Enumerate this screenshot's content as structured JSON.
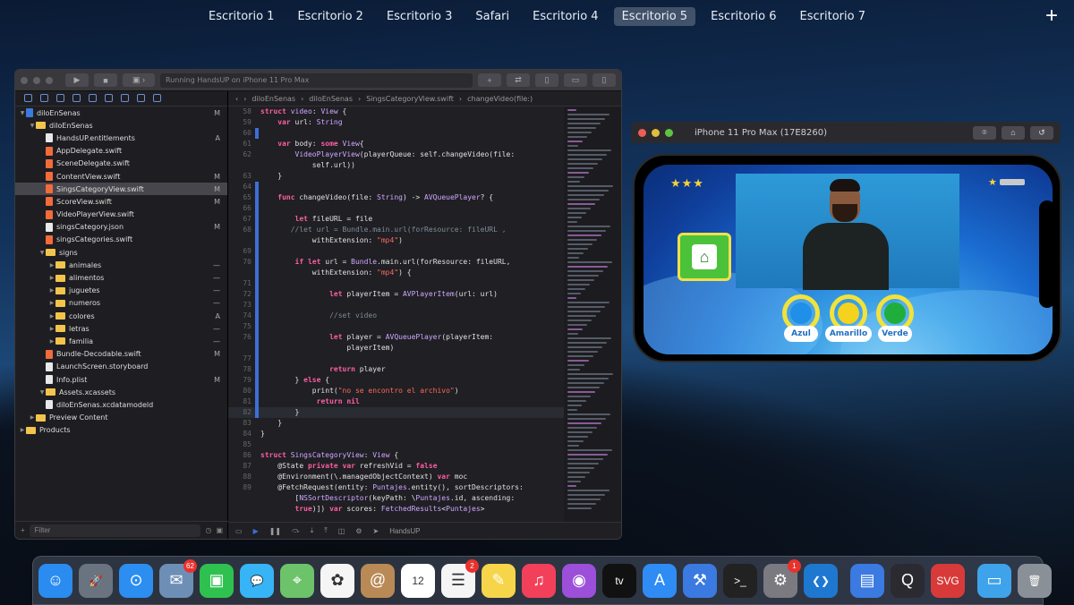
{
  "mission_control": {
    "desktops": [
      "Escritorio 1",
      "Escritorio 2",
      "Escritorio 3",
      "Safari",
      "Escritorio 4",
      "Escritorio 5",
      "Escritorio 6",
      "Escritorio 7"
    ],
    "active_index": 5,
    "add_label": "+"
  },
  "xcode": {
    "run_status": "Running HandsUP on iPhone 11 Pro Max",
    "jump_bar": [
      "diloEnSenas",
      "diloEnSenas",
      "SingsCategoryView.swift",
      "changeVideo(file:)"
    ],
    "navigator": [
      {
        "name": "diloEnSenas",
        "depth": 0,
        "kind": "project",
        "status": "M"
      },
      {
        "name": "diloEnSenas",
        "depth": 1,
        "kind": "folder",
        "status": ""
      },
      {
        "name": "HandsUP.entitlements",
        "depth": 2,
        "kind": "file",
        "status": "A"
      },
      {
        "name": "AppDelegate.swift",
        "depth": 2,
        "kind": "swift",
        "status": ""
      },
      {
        "name": "SceneDelegate.swift",
        "depth": 2,
        "kind": "swift",
        "status": ""
      },
      {
        "name": "ContentView.swift",
        "depth": 2,
        "kind": "swift",
        "status": "M"
      },
      {
        "name": "SingsCategoryView.swift",
        "depth": 2,
        "kind": "swift",
        "status": "M",
        "selected": true
      },
      {
        "name": "ScoreView.swift",
        "depth": 2,
        "kind": "swift",
        "status": "M"
      },
      {
        "name": "VideoPlayerView.swift",
        "depth": 2,
        "kind": "swift",
        "status": ""
      },
      {
        "name": "singsCategory.json",
        "depth": 2,
        "kind": "file",
        "status": "M"
      },
      {
        "name": "singsCategories.swift",
        "depth": 2,
        "kind": "swift",
        "status": ""
      },
      {
        "name": "signs",
        "depth": 2,
        "kind": "folder",
        "status": ""
      },
      {
        "name": "animales",
        "depth": 3,
        "kind": "folder",
        "status": "—"
      },
      {
        "name": "alimentos",
        "depth": 3,
        "kind": "folder",
        "status": "—"
      },
      {
        "name": "juguetes",
        "depth": 3,
        "kind": "folder",
        "status": "—"
      },
      {
        "name": "numeros",
        "depth": 3,
        "kind": "folder",
        "status": "—"
      },
      {
        "name": "colores",
        "depth": 3,
        "kind": "folder",
        "status": "A"
      },
      {
        "name": "letras",
        "depth": 3,
        "kind": "folder",
        "status": "—"
      },
      {
        "name": "familia",
        "depth": 3,
        "kind": "folder",
        "status": "—"
      },
      {
        "name": "Bundle-Decodable.swift",
        "depth": 2,
        "kind": "swift",
        "status": "M"
      },
      {
        "name": "LaunchScreen.storyboard",
        "depth": 2,
        "kind": "file",
        "status": ""
      },
      {
        "name": "Info.plist",
        "depth": 2,
        "kind": "file",
        "status": "M"
      },
      {
        "name": "Assets.xcassets",
        "depth": 2,
        "kind": "folder",
        "status": ""
      },
      {
        "name": "diloEnSenas.xcdatamodeld",
        "depth": 2,
        "kind": "file",
        "status": ""
      },
      {
        "name": "Preview Content",
        "depth": 1,
        "kind": "folder",
        "status": ""
      },
      {
        "name": "Products",
        "depth": 0,
        "kind": "folder",
        "status": ""
      }
    ],
    "filter_placeholder": "Filter",
    "debug_target": "HandsUP",
    "current_line": 82,
    "code": [
      {
        "n": 58,
        "t": "struct video: View {",
        "m": false
      },
      {
        "n": 59,
        "t": "    var url: String",
        "m": false
      },
      {
        "n": 60,
        "t": "",
        "m": true
      },
      {
        "n": 61,
        "t": "    var body: some View{",
        "m": false
      },
      {
        "n": 62,
        "t": "        VideoPlayerView(playerQueue: self.changeVideo(file:",
        "m": false
      },
      {
        "n": "",
        "t": "            self.url))",
        "m": false
      },
      {
        "n": 63,
        "t": "    }",
        "m": false
      },
      {
        "n": 64,
        "t": "",
        "m": true
      },
      {
        "n": 65,
        "t": "    func changeVideo(file: String) -> AVQueuePlayer? {",
        "m": true
      },
      {
        "n": 66,
        "t": "",
        "m": true
      },
      {
        "n": 67,
        "t": "        let fileURL = file",
        "m": true
      },
      {
        "n": 68,
        "t": "       //let url = Bundle.main.url(forResource: fileURL ,",
        "m": true
      },
      {
        "n": "",
        "t": "            withExtension: \"mp4\")",
        "m": true
      },
      {
        "n": 69,
        "t": "",
        "m": true
      },
      {
        "n": 70,
        "t": "        if let url = Bundle.main.url(forResource: fileURL,",
        "m": true
      },
      {
        "n": "",
        "t": "            withExtension: \"mp4\") {",
        "m": true
      },
      {
        "n": 71,
        "t": "",
        "m": true
      },
      {
        "n": 72,
        "t": "                let playerItem = AVPlayerItem(url: url)",
        "m": true
      },
      {
        "n": 73,
        "t": "",
        "m": true
      },
      {
        "n": 74,
        "t": "                //set video",
        "m": true
      },
      {
        "n": 75,
        "t": "",
        "m": true
      },
      {
        "n": 76,
        "t": "                let player = AVQueuePlayer(playerItem:",
        "m": true
      },
      {
        "n": "",
        "t": "                    playerItem)",
        "m": true
      },
      {
        "n": 77,
        "t": "",
        "m": true
      },
      {
        "n": 78,
        "t": "                return player",
        "m": true
      },
      {
        "n": 79,
        "t": "        } else {",
        "m": true
      },
      {
        "n": 80,
        "t": "            print(\"no se encontro el archivo\")",
        "m": true
      },
      {
        "n": 81,
        "t": "             return nil",
        "m": true
      },
      {
        "n": 82,
        "t": "        }",
        "m": true
      },
      {
        "n": 83,
        "t": "    }",
        "m": false
      },
      {
        "n": 84,
        "t": "}",
        "m": false
      },
      {
        "n": 85,
        "t": "",
        "m": false
      },
      {
        "n": 86,
        "t": "struct SingsCategoryView: View {",
        "m": false
      },
      {
        "n": 87,
        "t": "    @State private var refreshVid = false",
        "m": false
      },
      {
        "n": 88,
        "t": "    @Environment(\\.managedObjectContext) var moc",
        "m": false
      },
      {
        "n": 89,
        "t": "    @FetchRequest(entity: Puntajes.entity(), sortDescriptors:",
        "m": false
      },
      {
        "n": "",
        "t": "        [NSSortDescriptor(keyPath: \\Puntajes.id, ascending:",
        "m": false
      },
      {
        "n": "",
        "t": "        true)]) var scores: FetchedResults<Puntajes>",
        "m": false
      }
    ]
  },
  "simulator": {
    "title": "iPhone 11 Pro Max (17E8260)",
    "toolbar_icons": [
      "camera-icon",
      "home-icon",
      "rotate-icon"
    ],
    "app": {
      "answers": [
        {
          "label": "Azul",
          "color": "#1f8fe8"
        },
        {
          "label": "Amarillo",
          "color": "#f5d21d"
        },
        {
          "label": "Verde",
          "color": "#1fae3c"
        }
      ]
    }
  },
  "dock": {
    "apps": [
      {
        "name": "finder",
        "glyph": "☺",
        "bg": "#2a8cf0",
        "badge": ""
      },
      {
        "name": "launchpad",
        "glyph": "🚀",
        "bg": "#6a7380",
        "badge": ""
      },
      {
        "name": "safari",
        "glyph": "⊙",
        "bg": "#2b8ef0",
        "badge": ""
      },
      {
        "name": "mail",
        "glyph": "✉",
        "bg": "#6e8fb5",
        "badge": "62"
      },
      {
        "name": "facetime",
        "glyph": "▣",
        "bg": "#2fc150",
        "badge": ""
      },
      {
        "name": "messages",
        "glyph": "💬",
        "bg": "#37b4f5",
        "badge": ""
      },
      {
        "name": "maps",
        "glyph": "⌖",
        "bg": "#6cc36a",
        "badge": ""
      },
      {
        "name": "photos",
        "glyph": "✿",
        "bg": "#f5f5f5",
        "badge": ""
      },
      {
        "name": "contacts",
        "glyph": "@",
        "bg": "#b98a55",
        "badge": ""
      },
      {
        "name": "calendar",
        "glyph": "12",
        "bg": "#ffffff",
        "badge": ""
      },
      {
        "name": "reminders",
        "glyph": "☰",
        "bg": "#f5f5f5",
        "badge": "2"
      },
      {
        "name": "notes",
        "glyph": "✎",
        "bg": "#f6d54a",
        "badge": ""
      },
      {
        "name": "music",
        "glyph": "♫",
        "bg": "#f2405b",
        "badge": ""
      },
      {
        "name": "podcasts",
        "glyph": "◉",
        "bg": "#9c4fd8",
        "badge": ""
      },
      {
        "name": "tv",
        "glyph": "tv",
        "bg": "#111111",
        "badge": ""
      },
      {
        "name": "app-store",
        "glyph": "A",
        "bg": "#2f8cf5",
        "badge": ""
      },
      {
        "name": "xcode",
        "glyph": "⚒",
        "bg": "#3b7ae0",
        "badge": ""
      },
      {
        "name": "terminal",
        "glyph": ">_",
        "bg": "#222222",
        "badge": ""
      },
      {
        "name": "system-preferences",
        "glyph": "⚙",
        "bg": "#7a7a80",
        "badge": "1"
      },
      {
        "name": "vscode",
        "glyph": "❮❯",
        "bg": "#1f78d0",
        "badge": ""
      },
      {
        "name": "simulator",
        "glyph": "▤",
        "bg": "#3b7ae0",
        "badge": ""
      },
      {
        "name": "quicktime",
        "glyph": "Q",
        "bg": "#2a2a30",
        "badge": ""
      },
      {
        "name": "svg-app",
        "glyph": "SVG",
        "bg": "#d83a3a",
        "badge": ""
      },
      {
        "name": "downloads",
        "glyph": "▭",
        "bg": "#3ea3ea",
        "badge": ""
      },
      {
        "name": "trash",
        "glyph": "🗑",
        "bg": "#8a9098",
        "badge": ""
      }
    ]
  }
}
